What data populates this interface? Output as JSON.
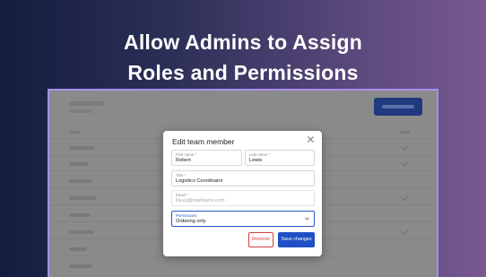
{
  "headline": {
    "line1": "Allow Admins to Assign",
    "line2": "Roles and Permissions"
  },
  "modal": {
    "title": "Edit team member",
    "close_icon": "close-icon",
    "fields": {
      "first_name": {
        "label": "First name *",
        "value": "Robert"
      },
      "last_name": {
        "label": "Last name *",
        "value": "Lewis"
      },
      "title": {
        "label": "Title *",
        "value": "Logistics Coordinator"
      },
      "email": {
        "label": "Email *",
        "value": "lilyuu@mailinator.com"
      },
      "permissions": {
        "label": "Permissions",
        "value": "Ordering only"
      }
    },
    "buttons": {
      "remove_label": "Remove",
      "save_label": "Save changes"
    }
  },
  "colors": {
    "accent": "#1f4fc4",
    "danger": "#d2403c",
    "frame_border": "#a98ff0"
  }
}
